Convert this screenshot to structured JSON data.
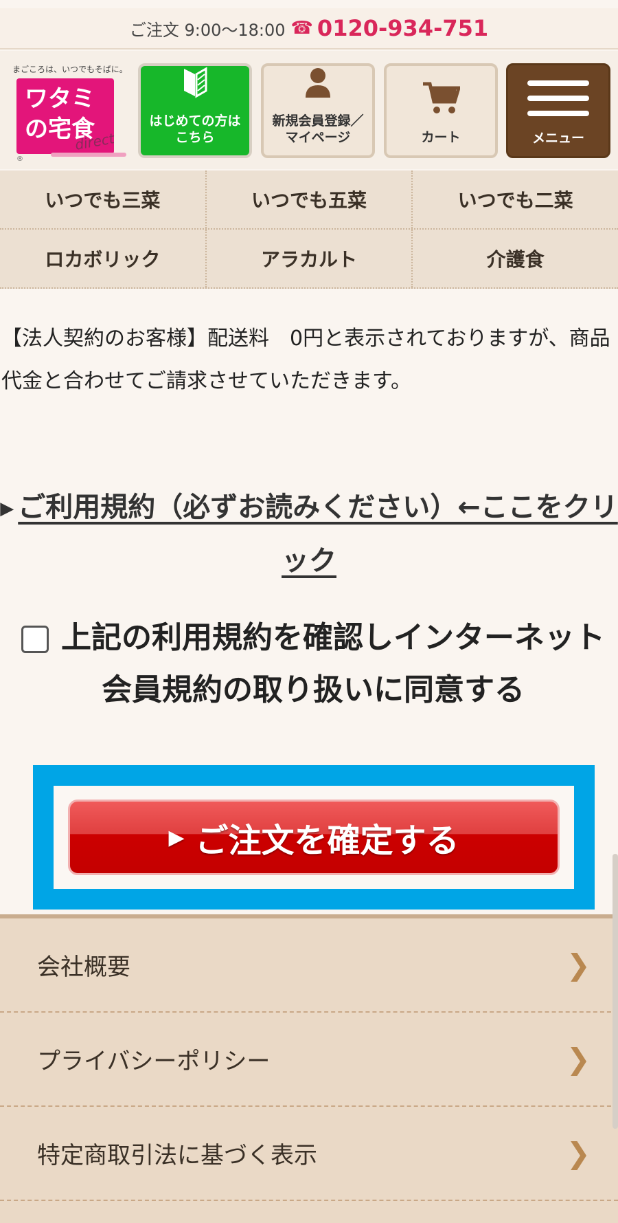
{
  "topbar": {
    "hours": "ご注文 9:00〜18:00",
    "phone_icon": "phone-icon",
    "phone": "0120-934-751"
  },
  "logo": {
    "tagline": "まごころは、いつでもそばに。",
    "line1": "ワタミ",
    "line2": "の宅食",
    "direct": "direct",
    "reg": "®"
  },
  "header_buttons": {
    "first": "はじめての方は\nこちら",
    "member": "新規会員登録／\nマイページ",
    "cart": "カート",
    "menu": "メニュー"
  },
  "nav": [
    [
      "いつでも三菜",
      "いつでも五菜",
      "いつでも二菜"
    ],
    [
      "ロカボリック",
      "アラカルト",
      "介護食"
    ]
  ],
  "notice": "【法人契約のお客様】配送料　0円と表示されておりますが、商品代金と合わせてご請求させていただきます。",
  "terms": {
    "bullet": "▶",
    "link": "ご利用規約（必ずお読みください）←ここをクリック"
  },
  "agree": {
    "label": "上記の利用規約を確認しインターネット会員規約の取り扱いに同意する",
    "checked": false
  },
  "order_button": {
    "bullet": "▶",
    "label": "ご注文を確定する"
  },
  "colors": {
    "accent_pink": "#d9275a",
    "green": "#17b72a",
    "order_red": "#cc0000",
    "highlight_blue": "#00a5e6"
  },
  "footer": [
    {
      "label": "会社概要",
      "icon": "chevron-right-icon"
    },
    {
      "label": "プライバシーポリシー",
      "icon": "chevron-right-icon"
    },
    {
      "label": "特定商取引法に基づく表示",
      "icon": "chevron-right-icon"
    }
  ]
}
